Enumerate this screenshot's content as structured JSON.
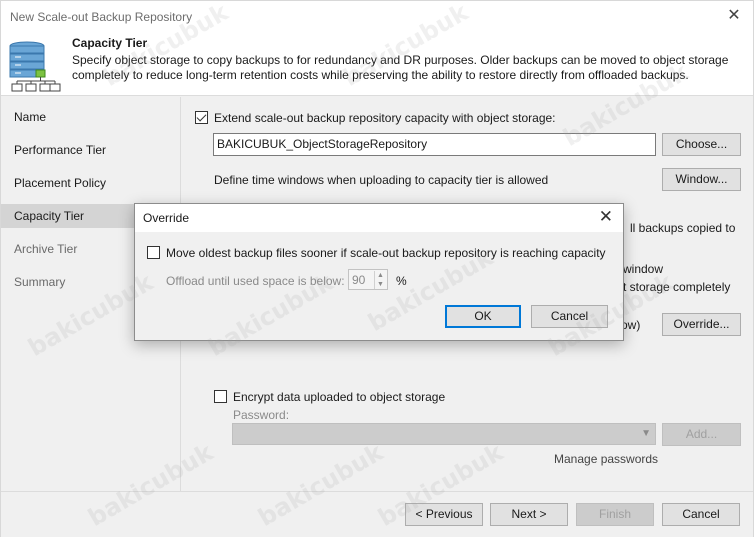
{
  "window": {
    "title": "New Scale-out Backup Repository",
    "close_glyph": "✕"
  },
  "header": {
    "title": "Capacity Tier",
    "description": "Specify object storage to copy backups to for redundancy and DR purposes. Older backups can be moved to object storage completely to reduce long-term retention costs while preserving the ability to restore directly from offloaded backups."
  },
  "sidebar": {
    "items": [
      {
        "label": "Name"
      },
      {
        "label": "Performance Tier"
      },
      {
        "label": "Placement Policy"
      },
      {
        "label": "Capacity Tier"
      },
      {
        "label": "Archive Tier"
      },
      {
        "label": "Summary"
      }
    ],
    "active_index": 3
  },
  "content": {
    "extend_checkbox_label": "Extend scale-out backup repository capacity with object storage:",
    "extend_checked": true,
    "repository_value": "BAKICUBUK_ObjectStorageRepository",
    "choose_button": "Choose...",
    "time_window_label": "Define time windows when uploading to capacity tier is allowed",
    "window_button": "Window...",
    "partial_copy_text": "ll backups copied to",
    "partial_window_text": "window",
    "partial_move_text": "t storage completely",
    "partial_ow_text": "ow)",
    "override_button": "Override...",
    "encrypt_label": "Encrypt data uploaded to object storage",
    "encrypt_checked": false,
    "password_label": "Password:",
    "add_button": "Add...",
    "manage_passwords": "Manage passwords"
  },
  "footer": {
    "previous": "< Previous",
    "next": "Next >",
    "finish": "Finish",
    "cancel": "Cancel"
  },
  "dialog": {
    "title": "Override",
    "close_glyph": "✕",
    "move_label": "Move oldest backup files sooner if scale-out backup repository is reaching capacity",
    "move_checked": false,
    "offload_label": "Offload until used space is below:",
    "offload_value": "90",
    "percent": "%",
    "ok": "OK",
    "cancel": "Cancel"
  },
  "watermark": "bakicubuk",
  "colors": {
    "accent": "#0078d7",
    "window_bg": "#f0f0f0",
    "selected_nav": "#d4d4d4"
  }
}
